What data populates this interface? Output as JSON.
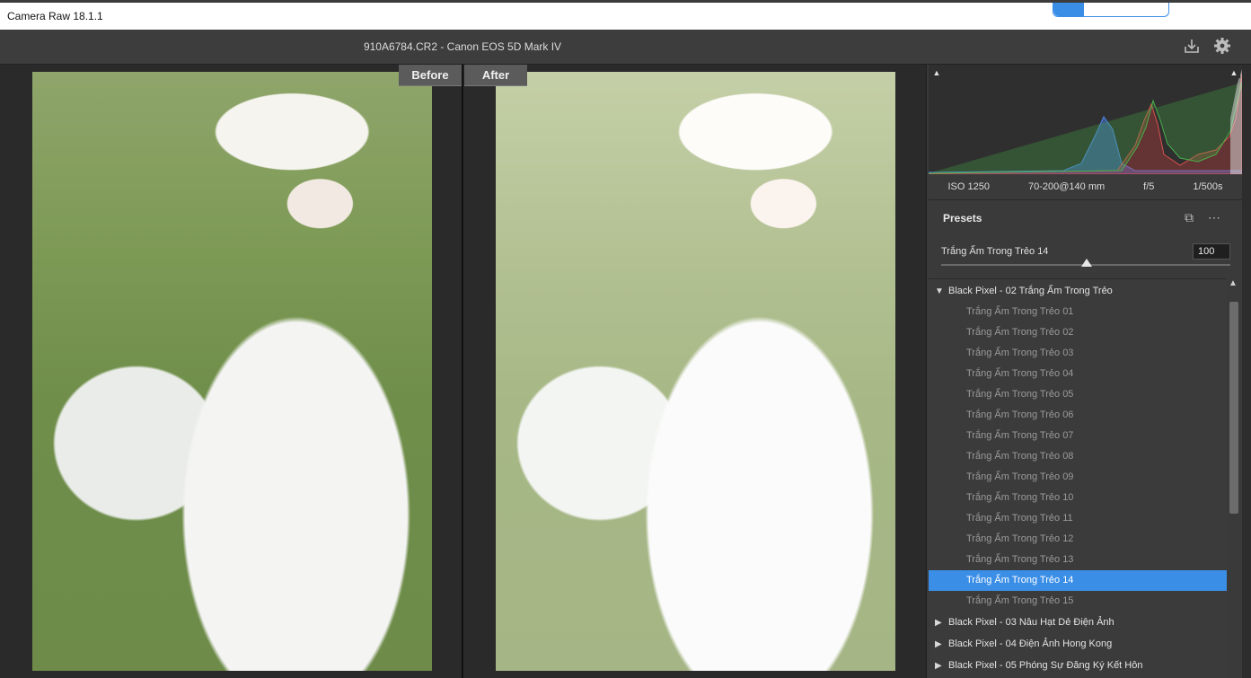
{
  "app": {
    "title": "Camera Raw 18.1.1"
  },
  "file": {
    "name": "910A6784.CR2  -  Canon EOS 5D Mark IV"
  },
  "compare": {
    "before": "Before",
    "after": "After"
  },
  "exif": {
    "iso": "ISO 1250",
    "lens": "70-200@140 mm",
    "aperture": "f/5",
    "shutter": "1/500s"
  },
  "presets": {
    "header": "Presets",
    "amount_label": "Trắng Ấm Trong Trẻo 14",
    "amount_value": "100",
    "amount_fraction": 0.5,
    "groups": [
      {
        "label": "Black Pixel - 02 Trắng Ấm Trong Trẻo",
        "expanded": true,
        "items": [
          "Trắng Ấm Trong Trẻo 01",
          "Trắng Ấm Trong Trẻo 02",
          "Trắng Ấm Trong Trẻo 03",
          "Trắng Ấm Trong Trẻo 04",
          "Trắng Ấm Trong Trẻo 05",
          "Trắng Ấm Trong Trẻo 06",
          "Trắng Ấm Trong Trẻo 07",
          "Trắng Ấm Trong Trẻo 08",
          "Trắng Ấm Trong Trẻo 09",
          "Trắng Ấm Trong Trẻo 10",
          "Trắng Ấm Trong Trẻo 11",
          "Trắng Ấm Trong Trẻo 12",
          "Trắng Ấm Trong Trẻo 13",
          "Trắng Ấm Trong Trẻo 14",
          "Trắng Ấm Trong Trẻo 15"
        ],
        "selected": "Trắng Ấm Trong Trẻo 14"
      },
      {
        "label": "Black Pixel - 03 Nâu Hạt Dẻ Điện Ảnh",
        "expanded": false
      },
      {
        "label": "Black Pixel - 04 Điện Ảnh Hong Kong",
        "expanded": false
      },
      {
        "label": "Black Pixel - 05 Phóng Sự Đăng Ký Kết Hôn",
        "expanded": false
      }
    ]
  },
  "icons": {
    "save": "download-icon",
    "settings": "gear-icon"
  },
  "colors": {
    "selected": "#3a8ee6",
    "panel": "#3a3a3a"
  }
}
